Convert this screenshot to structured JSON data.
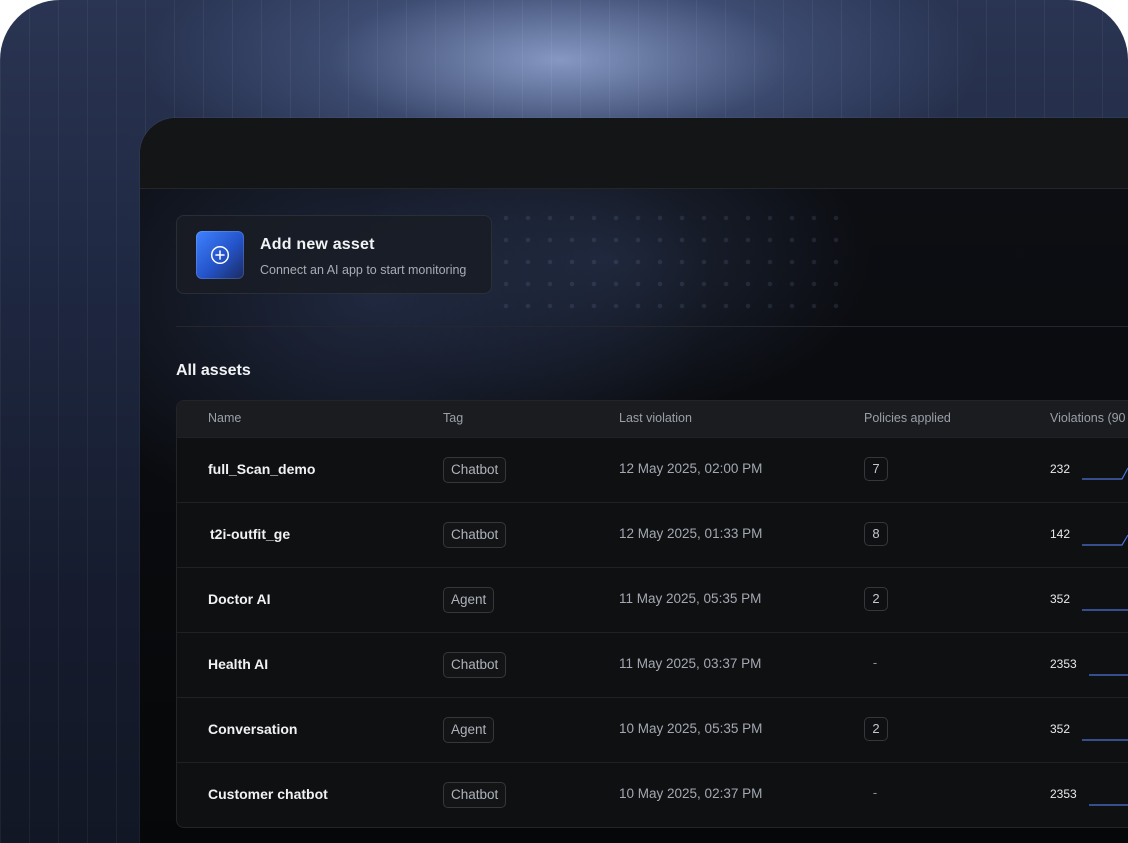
{
  "add_asset": {
    "title": "Add new asset",
    "subtitle": "Connect an AI app to start monitoring"
  },
  "section_title": "All assets",
  "table": {
    "columns": [
      "Name",
      "Tag",
      "Last violation",
      "Policies applied",
      "Violations (90"
    ],
    "rows": [
      {
        "name": "full_Scan_demo",
        "tag": "Chatbot",
        "last_violation": "12 May 2025, 02:00 PM",
        "policies": "7",
        "violations": "232"
      },
      {
        "name": "t2i-outfit_ge",
        "tag": "Chatbot",
        "last_violation": "12 May 2025, 01:33 PM",
        "policies": "8",
        "violations": "142"
      },
      {
        "name": "Doctor AI",
        "tag": "Agent",
        "last_violation": "11 May 2025, 05:35 PM",
        "policies": "2",
        "violations": "352"
      },
      {
        "name": "Health AI",
        "tag": "Chatbot",
        "last_violation": "11 May 2025, 03:37 PM",
        "policies": "-",
        "violations": "2353"
      },
      {
        "name": "Conversation",
        "tag": "Agent",
        "last_violation": "10 May 2025, 05:35 PM",
        "policies": "2",
        "violations": "352"
      },
      {
        "name": "Customer chatbot",
        "tag": "Chatbot",
        "last_violation": "10 May 2025, 02:37 PM",
        "policies": "-",
        "violations": "2353"
      }
    ]
  },
  "colors": {
    "accent": "#3f82ff",
    "sparkline": "#4d73d9",
    "background": "#070809"
  },
  "icons": {
    "add": "plus-circle-icon"
  }
}
